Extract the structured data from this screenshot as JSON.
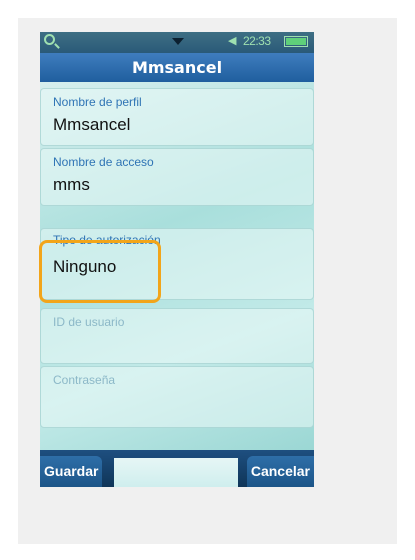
{
  "status_bar": {
    "time": "22:33",
    "icons": [
      "search-icon",
      "dropdown-arrow-icon",
      "speaker-icon",
      "battery-icon"
    ]
  },
  "header": {
    "title": "Mmsancel"
  },
  "fields": [
    {
      "label": "Nombre de perfil",
      "value": "Mmsancel"
    },
    {
      "label": "Nombre de acceso",
      "value": "mms"
    },
    {
      "label": "Tipo de autorización",
      "value": "Ninguno"
    },
    {
      "label": "ID de usuario",
      "value": ""
    },
    {
      "label": "Contraseña",
      "value": ""
    }
  ],
  "softkeys": {
    "left": "Guardar",
    "right": "Cancelar"
  },
  "colors": {
    "highlight": "#f2a51a",
    "label": "#2f74b5",
    "title_bar": "#2a69a9"
  }
}
